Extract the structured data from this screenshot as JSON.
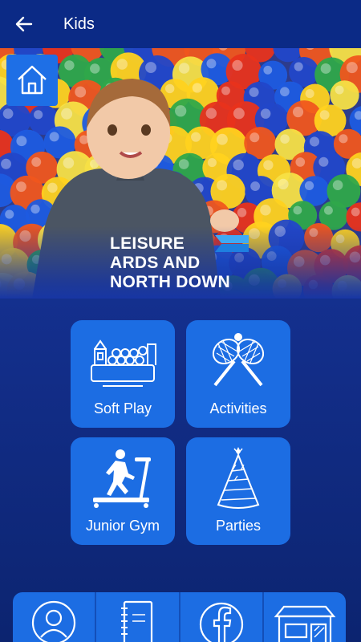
{
  "header": {
    "title": "Kids",
    "back_icon": "arrow-left-icon"
  },
  "hero": {
    "home_icon": "home-icon",
    "logo_lines": [
      "LEISURE",
      "ARDS AND",
      "NORTH DOWN"
    ]
  },
  "tiles": [
    {
      "label": "Soft Play",
      "icon": "soft-play-icon"
    },
    {
      "label": "Activities",
      "icon": "tennis-rackets-icon"
    },
    {
      "label": "Junior Gym",
      "icon": "treadmill-icon"
    },
    {
      "label": "Parties",
      "icon": "party-hat-icon"
    }
  ],
  "bottom_nav": [
    {
      "icon": "profile-icon"
    },
    {
      "icon": "notebook-icon"
    },
    {
      "icon": "facebook-icon"
    },
    {
      "icon": "leisure-centre-icon"
    }
  ],
  "colors": {
    "topbar": "#0b2a86",
    "tile": "#1c6de3",
    "background": "#14308f",
    "logo_accent": "#3fa9f5"
  }
}
